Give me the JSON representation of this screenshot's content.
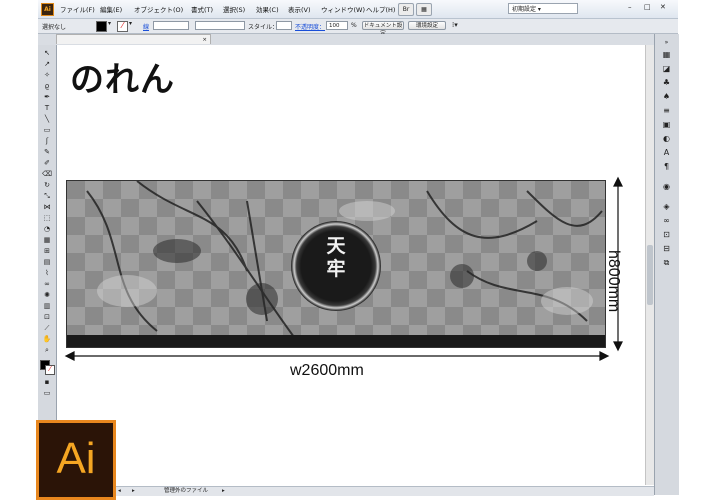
{
  "app": {
    "icon_label": "Ai",
    "menus": [
      "ファイル(F)",
      "編集(E)",
      "オブジェクト(O)",
      "書式(T)",
      "選択(S)",
      "効果(C)",
      "表示(V)",
      "ウィンドウ(W)",
      "ヘルプ(H)"
    ],
    "workspace": "初期設定 ▾"
  },
  "control_bar": {
    "selection_status": "選択なし",
    "stroke_label": "線",
    "style_label": "スタイル：",
    "opacity_label": "不透明度：",
    "opacity_value": "100",
    "opacity_unit": "%",
    "doc_settings_button": "ドキュメント設定",
    "preferences_button": "環境設定"
  },
  "document_tab": {
    "title": ""
  },
  "canvas": {
    "title": "のれん",
    "brand_mark": "天\n牢",
    "width_label": "w2600mm",
    "height_label": "h800mm"
  },
  "status_bar": {
    "text": "管理外のファイル"
  },
  "logo": {
    "text": "Ai"
  },
  "colors": {
    "accent": "#e8871e",
    "logo_bg": "#2b1407",
    "logo_text": "#f5a623",
    "link": "#1a4fd8"
  }
}
